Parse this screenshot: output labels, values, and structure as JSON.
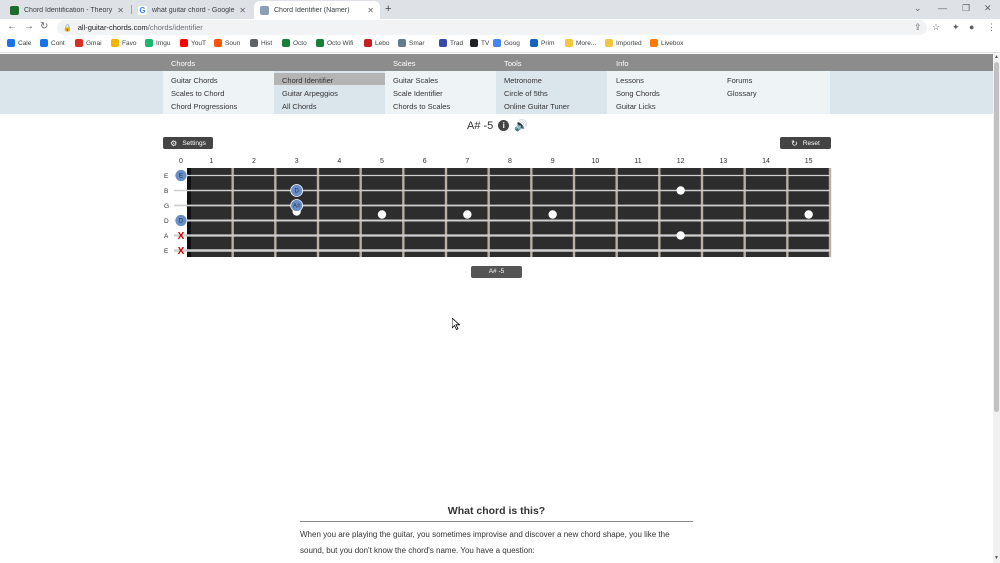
{
  "browser": {
    "tabs": [
      {
        "title": "Chord Identification - Theory and...",
        "favicon_color": "#1e6b2e",
        "active": false
      },
      {
        "title": "what guitar chord - Google Search",
        "favicon_color": "#4285f4",
        "active": false
      },
      {
        "title": "Chord Identifier (Namer)",
        "favicon_color": "#8aa0b4",
        "active": true
      }
    ],
    "new_tab_glyph": "+",
    "url_host": "all-guitar-chords.com",
    "url_path": "/chords/identifier",
    "bookmarks": [
      {
        "label": "Cale",
        "color": "#1a73e8"
      },
      {
        "label": "Cont",
        "color": "#1a73e8"
      },
      {
        "label": "Gmai",
        "color": "#d93025"
      },
      {
        "label": "Favo",
        "color": "#f4b400"
      },
      {
        "label": "Imgu",
        "color": "#1bb76e"
      },
      {
        "label": "YouT",
        "color": "#ff0000"
      },
      {
        "label": "Soun",
        "color": "#ff5500"
      },
      {
        "label": "Hist",
        "color": "#5f6368"
      },
      {
        "label": "Octo",
        "color": "#188038"
      },
      {
        "label": "Octo Wifi",
        "color": "#188038"
      },
      {
        "label": "Lebo",
        "color": "#c5221f"
      },
      {
        "label": "Smar",
        "color": "#607d8b"
      },
      {
        "label": "Trad",
        "color": "#3949ab"
      },
      {
        "label": "TV",
        "color": "#202124"
      },
      {
        "label": "Goog",
        "color": "#4285f4"
      },
      {
        "label": "Prim",
        "color": "#1565c0"
      },
      {
        "label": "More...",
        "color": "#f4c542"
      },
      {
        "label": "Imported",
        "color": "#f4c542"
      },
      {
        "label": "Livebox",
        "color": "#ff7900"
      }
    ]
  },
  "site_nav": {
    "categories": [
      "Chords",
      "Scales",
      "Tools",
      "Info"
    ],
    "columns": [
      [
        "Guitar Chords",
        "Scales to Chord",
        "Chord Progressions"
      ],
      [
        "Chord Identifier",
        "Guitar Arpeggios",
        "All Chords"
      ],
      [
        "Guitar Scales",
        "Scale Identifier",
        "Chords to Scales"
      ],
      [
        "Metronome",
        "Circle of 5ths",
        "Online Guitar Tuner"
      ],
      [
        "Lessons",
        "Song Chords",
        "Guitar Licks"
      ],
      [
        "Forums",
        "Glossary"
      ]
    ],
    "active_item": "Chord Identifier"
  },
  "chord": {
    "name": "A# -5",
    "settings_label": "Settings",
    "reset_label": "Reset",
    "label_below": "A# -5"
  },
  "fretboard": {
    "fret_numbers": [
      "0",
      "1",
      "2",
      "3",
      "4",
      "5",
      "6",
      "7",
      "8",
      "9",
      "10",
      "11",
      "12",
      "13",
      "14",
      "15"
    ],
    "strings": [
      "E",
      "B",
      "G",
      "D",
      "A",
      "E"
    ],
    "muted_symbol": "X",
    "notes": [
      {
        "string": 0,
        "fret": 0,
        "label": "E"
      },
      {
        "string": 1,
        "fret": 3,
        "label": "D"
      },
      {
        "string": 2,
        "fret": 3,
        "label": "A#"
      },
      {
        "string": 3,
        "fret": 0,
        "label": "D"
      }
    ],
    "muted_strings": [
      4,
      5
    ],
    "inlay_frets": [
      3,
      5,
      7,
      9,
      15
    ],
    "double_inlay_fret": 12,
    "note_color": "#6a8fc7",
    "board_color": "#2d2d2d",
    "muted_color": "#cc0000"
  },
  "article": {
    "heading": "What chord is this?",
    "paragraph": "When you are playing the guitar, you sometimes improvise and discover a new chord shape, you like the sound, but you don't know the chord's name. You have a question:"
  }
}
